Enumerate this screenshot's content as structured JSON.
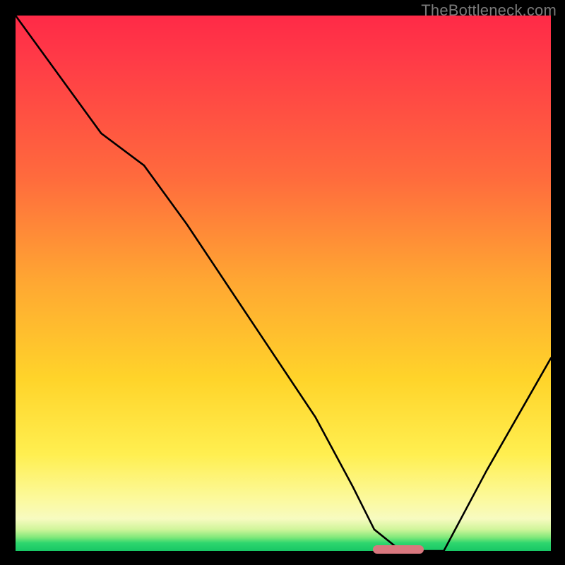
{
  "watermark": "TheBottleneck.com",
  "chart_data": {
    "type": "line",
    "title": "",
    "xlabel": "",
    "ylabel": "",
    "xlim": [
      0,
      100
    ],
    "ylim": [
      0,
      100
    ],
    "x": [
      0,
      8,
      16,
      24,
      32,
      40,
      48,
      56,
      63,
      67,
      72,
      80,
      88,
      96,
      100
    ],
    "values": [
      100,
      89,
      78,
      72,
      61,
      49,
      37,
      25,
      12,
      4,
      0,
      0,
      15,
      29,
      36
    ],
    "marker": {
      "x_start": 67,
      "x_end": 76,
      "y": 0
    },
    "colors": {
      "top": "#ff2a47",
      "mid": "#ffd42a",
      "bottom": "#18c765",
      "curve": "#000000",
      "marker": "#d9777e",
      "watermark": "#7a7a7a"
    }
  }
}
